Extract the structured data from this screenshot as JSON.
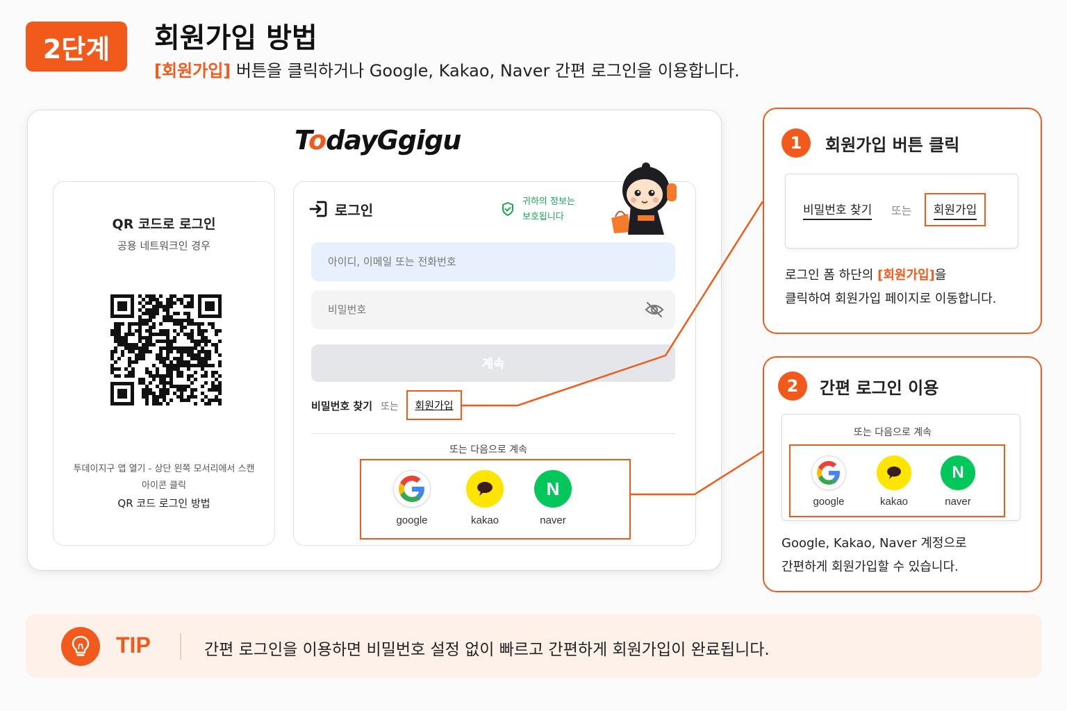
{
  "header": {
    "step_badge": "2단계",
    "title": "회원가입 방법",
    "subtitle_highlight": "[회원가입]",
    "subtitle_rest": " 버튼을 클릭하거나 Google, Kakao, Naver 간편 로그인을 이용합니다."
  },
  "logo": {
    "t": "T",
    "o": "o",
    "rest": "dayGgigu"
  },
  "qr_card": {
    "title": "QR 코드로 로그인",
    "subtitle": "공용 네트워크인 경우",
    "desc_line1": "투데이지구 앱 열기 - 상단 왼쪽 모서리에서 스캔",
    "desc_line2": "아이콘 클릭",
    "method": "QR 코드 로그인 방법"
  },
  "login_card": {
    "title": "로그인",
    "secure_line1": "귀하의 정보는",
    "secure_line2": "보호됩니다",
    "id_placeholder": "아이디, 이메일 또는 전화번호",
    "pw_placeholder": "비밀번호",
    "continue_label": "계속",
    "find_password": "비밀번호 찾기",
    "or": "또는",
    "signup": "회원가입",
    "or_continue": "또는 다음으로 계속",
    "social": [
      {
        "id": "google",
        "label": "google"
      },
      {
        "id": "kakao",
        "label": "kakao"
      },
      {
        "id": "naver",
        "label": "naver",
        "glyph": "N"
      }
    ]
  },
  "callout1": {
    "number": "1",
    "title": "회원가입 버튼 클릭",
    "find_password": "비밀번호 찾기",
    "or": "또는",
    "signup": "회원가입",
    "desc_pre": "로그인 폼 하단의 ",
    "desc_highlight": "[회원가입]",
    "desc_post": "을",
    "desc_line2": "클릭하여 회원가입 페이지로 이동합니다."
  },
  "callout2": {
    "number": "2",
    "title": "간편 로그인 이용",
    "or_continue": "또는 다음으로 계속",
    "social": [
      {
        "id": "google",
        "label": "google"
      },
      {
        "id": "kakao",
        "label": "kakao"
      },
      {
        "id": "naver",
        "label": "naver",
        "glyph": "N"
      }
    ],
    "desc_line1": "Google, Kakao, Naver 계정으로",
    "desc_line2": "간편하게 회원가입할 수 있습니다."
  },
  "tip": {
    "label": "TIP",
    "text": "간편 로그인을 이용하면 비밀번호 설정 없이 빠르고 간편하게 회원가입이 완료됩니다."
  },
  "colors": {
    "accent": "#f25a1c",
    "secure_green": "#1ea552",
    "kakao_yellow": "#fee500",
    "naver_green": "#03c75a"
  }
}
